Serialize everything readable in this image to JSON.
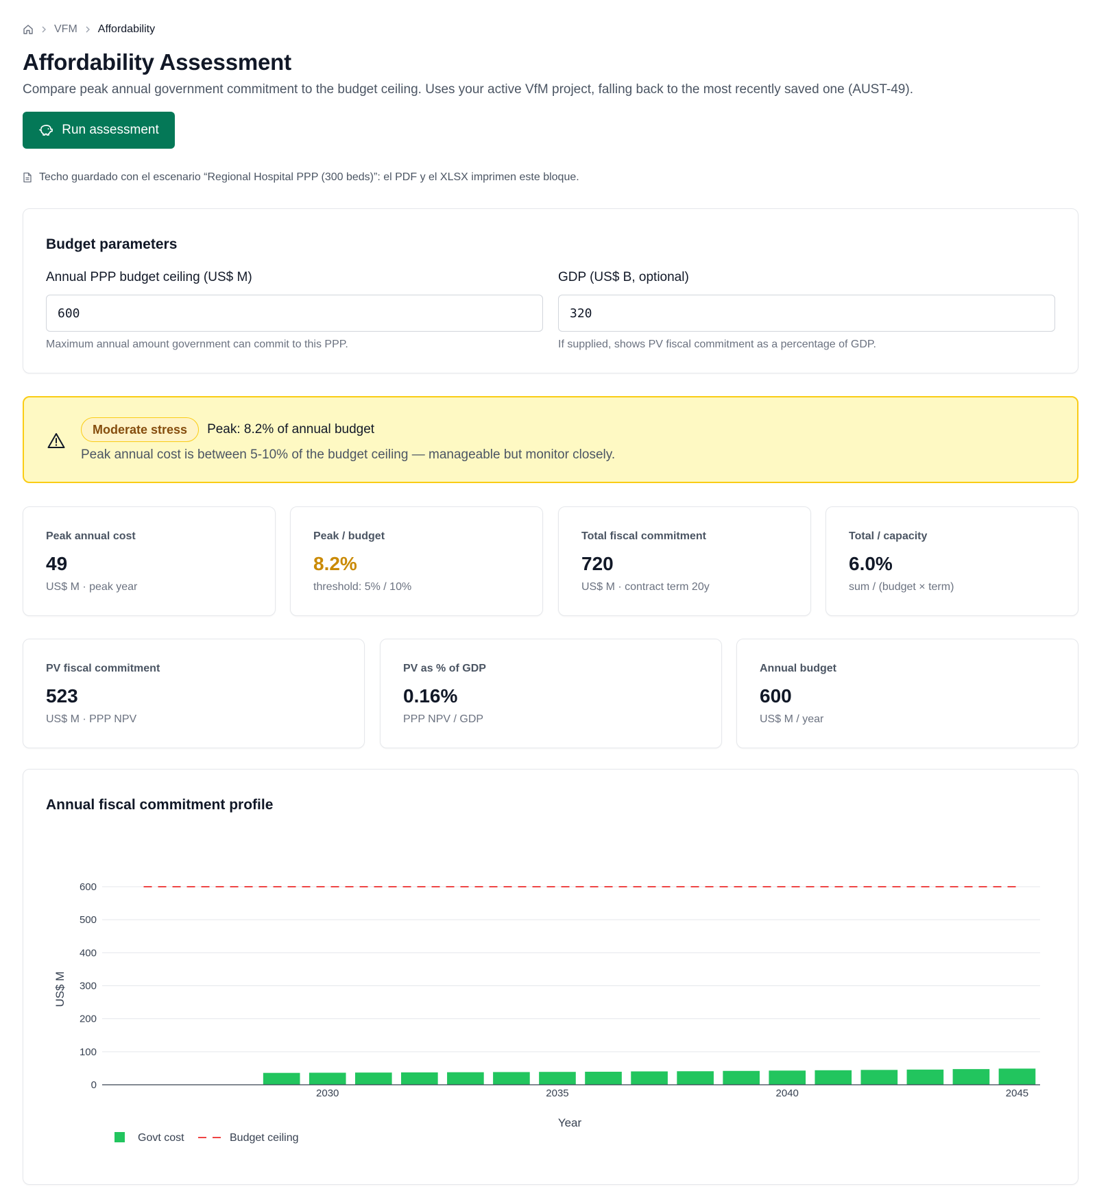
{
  "breadcrumb": {
    "items": [
      "VFM",
      "Affordability"
    ]
  },
  "page": {
    "title": "Affordability Assessment",
    "description": "Compare peak annual government commitment to the budget ceiling. Uses your active VfM project, falling back to the most recently saved one (AUST-49)."
  },
  "actions": {
    "run_label": "Run assessment"
  },
  "note": "Techo guardado con el escenario “Regional Hospital PPP (300 beds)”: el PDF y el XLSX imprimen este bloque.",
  "params": {
    "title": "Budget parameters",
    "ceiling": {
      "label": "Annual PPP budget ceiling (US$ M)",
      "value": "600",
      "hint": "Maximum annual amount government can commit to this PPP."
    },
    "gdp": {
      "label": "GDP (US$ B, optional)",
      "value": "320",
      "hint": "If supplied, shows PV fiscal commitment as a percentage of GDP."
    }
  },
  "alert": {
    "badge": "Moderate stress",
    "headline": "Peak: 8.2% of annual budget",
    "description": "Peak annual cost is between 5-10% of the budget ceiling — manageable but monitor closely.",
    "colors": {
      "background": "#fef9c3",
      "border": "#facc15",
      "text": "#854d0e"
    }
  },
  "kpis_row1": [
    {
      "label": "Peak annual cost",
      "value": "49",
      "sub": "US$ M · peak year"
    },
    {
      "label": "Peak / budget",
      "value": "8.2%",
      "sub": "threshold: 5% / 10%",
      "color": "#ca8a04"
    },
    {
      "label": "Total fiscal commitment",
      "value": "720",
      "sub": "US$ M · contract term 20y"
    },
    {
      "label": "Total / capacity",
      "value": "6.0%",
      "sub": "sum / (budget × term)"
    }
  ],
  "kpis_row2": [
    {
      "label": "PV fiscal commitment",
      "value": "523",
      "sub": "US$ M · PPP NPV"
    },
    {
      "label": "PV as % of GDP",
      "value": "0.16%",
      "sub": "PPP NPV / GDP"
    },
    {
      "label": "Annual budget",
      "value": "600",
      "sub": "US$ M / year"
    }
  ],
  "chart": {
    "title": "Annual fiscal commitment profile"
  },
  "chart_data": {
    "type": "bar",
    "xlabel": "Year",
    "ylabel": "US$ M",
    "ylim": [
      0,
      600
    ],
    "yticks": [
      0,
      100,
      200,
      300,
      400,
      500,
      600
    ],
    "xticks": [
      2030,
      2035,
      2040,
      2045
    ],
    "x": [
      2026,
      2027,
      2028,
      2029,
      2030,
      2031,
      2032,
      2033,
      2034,
      2035,
      2036,
      2037,
      2038,
      2039,
      2040,
      2041,
      2042,
      2043,
      2044,
      2045
    ],
    "series": [
      {
        "name": "Govt cost",
        "type": "bar",
        "color": "#22c55e",
        "values": [
          0,
          0,
          0,
          36,
          36.5,
          37,
          37.5,
          38,
          38.5,
          39,
          39.5,
          40.5,
          41,
          42,
          43,
          44,
          45,
          46,
          47.5,
          49
        ]
      },
      {
        "name": "Budget ceiling",
        "type": "line",
        "style": "dashed",
        "color": "#ef4444",
        "values": [
          600,
          600,
          600,
          600,
          600,
          600,
          600,
          600,
          600,
          600,
          600,
          600,
          600,
          600,
          600,
          600,
          600,
          600,
          600,
          600
        ]
      }
    ],
    "grid": true,
    "legend": "bottom-left"
  }
}
